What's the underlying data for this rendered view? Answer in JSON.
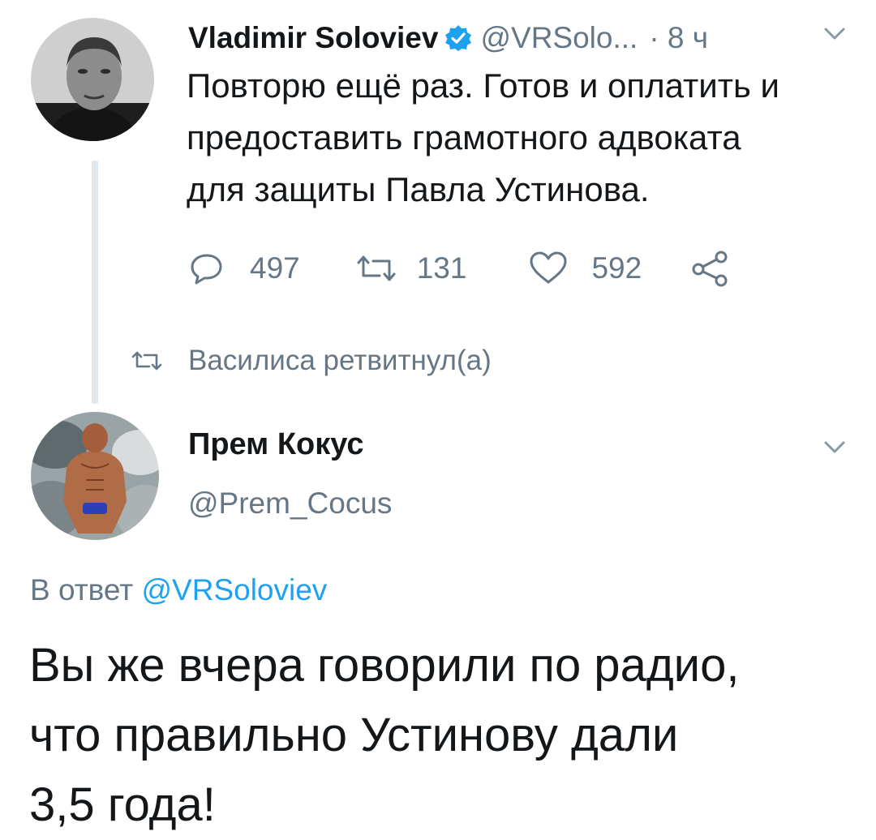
{
  "tweet": {
    "author_name": "Vladimir Soloviev",
    "author_handle": "@VRSolo...",
    "time": "· 8 ч",
    "text_lines": [
      "Повторю ещё раз. Готов и оплатить и",
      "предоставить грамотного адвоката",
      "для защиты Павла Устинова."
    ],
    "replies": "497",
    "retweets": "131",
    "likes": "592",
    "icons": [
      "verified-badge-icon",
      "chevron-down-icon",
      "reply-icon",
      "retweet-icon",
      "like-icon",
      "share-icon"
    ]
  },
  "retweet_context": {
    "text": "Василиса ретвитнул(а)",
    "icon": "retweet-icon"
  },
  "reply": {
    "author_name": "Прем Кокус",
    "author_handle": "@Prem_Cocus",
    "reply_prefix": "В ответ",
    "reply_mention": "@VRSoloviev",
    "text_lines": [
      "Вы же вчера говорили по радио,",
      "что правильно Устинову дали",
      "3,5 года!"
    ],
    "icons": [
      "chevron-down-icon"
    ]
  },
  "colors": {
    "accent": "#1da1f2",
    "secondary_text": "#657786",
    "primary_text": "#14171a",
    "thread_line": "#e1e8ed"
  }
}
